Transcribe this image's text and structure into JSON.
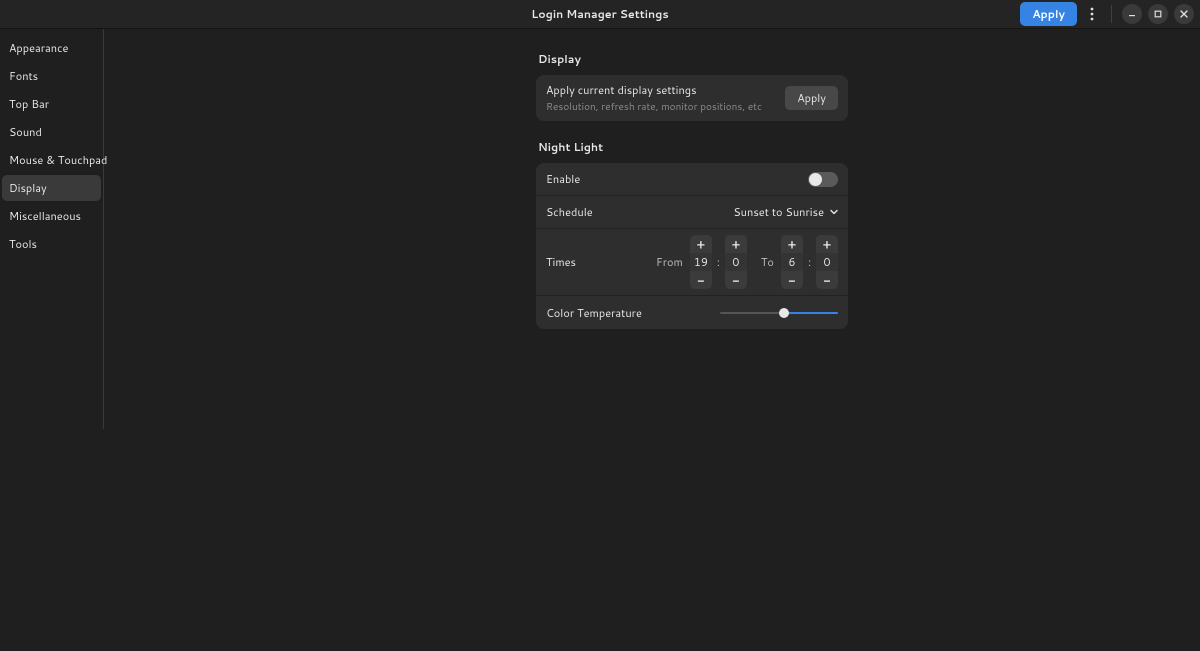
{
  "header": {
    "title": "Login Manager Settings",
    "apply_label": "Apply"
  },
  "sidebar": {
    "items": [
      {
        "label": "Appearance"
      },
      {
        "label": "Fonts"
      },
      {
        "label": "Top Bar"
      },
      {
        "label": "Sound"
      },
      {
        "label": "Mouse & Touchpad"
      },
      {
        "label": "Display"
      },
      {
        "label": "Miscellaneous"
      },
      {
        "label": "Tools"
      }
    ],
    "active_index": 5
  },
  "main": {
    "display_section": {
      "title": "Display",
      "apply_row": {
        "label": "Apply current display settings",
        "sub": "Resolution, refresh rate, monitor positions, etc",
        "button": "Apply"
      }
    },
    "nightlight_section": {
      "title": "Night Light",
      "enable_label": "Enable",
      "enable_on": false,
      "schedule_label": "Schedule",
      "schedule_value": "Sunset to Sunrise",
      "times_label": "Times",
      "from_label": "From",
      "to_label": "To",
      "from_h": "19",
      "from_m": "0",
      "to_h": "6",
      "to_m": "0",
      "color_temp_label": "Color Temperature",
      "color_temp_pct": 55
    }
  }
}
